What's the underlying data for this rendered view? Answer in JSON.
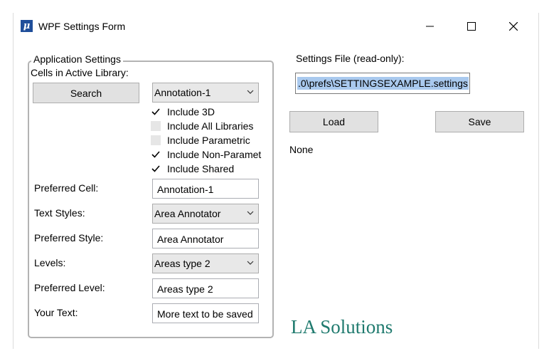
{
  "window": {
    "title": "WPF Settings Form",
    "app_icon_glyph": "μ",
    "controls": [
      "minimize-icon",
      "maximize-icon",
      "close-icon"
    ]
  },
  "group": {
    "legend": "Application Settings",
    "cells_label": "Cells in Active Library:",
    "search_label": "Search",
    "cell_combo_value": "Annotation-1",
    "checkboxes": [
      {
        "label": "Include 3D",
        "checked": true
      },
      {
        "label": "Include All Libraries",
        "checked": false
      },
      {
        "label": "Include Parametric",
        "checked": false
      },
      {
        "label": "Include Non-Paramet",
        "checked": true
      },
      {
        "label": "Include Shared",
        "checked": true
      }
    ],
    "preferred_cell_label": "Preferred Cell:",
    "preferred_cell_value": "Annotation-1",
    "text_styles_label": "Text Styles:",
    "text_styles_value": "Area Annotator",
    "preferred_style_label": "Preferred Style:",
    "preferred_style_value": "Area Annotator",
    "levels_label": "Levels:",
    "levels_value": "Areas type 2",
    "preferred_level_label": "Preferred Level:",
    "preferred_level_value": "Areas type 2",
    "your_text_label": "Your Text:",
    "your_text_value": "More text to be saved"
  },
  "settings": {
    "file_label": "Settings File (read-only):",
    "file_value": ".0\\prefs\\SETTINGSEXAMPLE.settings",
    "load_label": "Load",
    "save_label": "Save",
    "status": "None"
  },
  "brand": "LA Solutions",
  "colors": {
    "brand": "#1f7a6e",
    "selection": "#a9c9ee",
    "button_bg": "#e1e1e1",
    "icon_bg": "#1f4e9a"
  }
}
